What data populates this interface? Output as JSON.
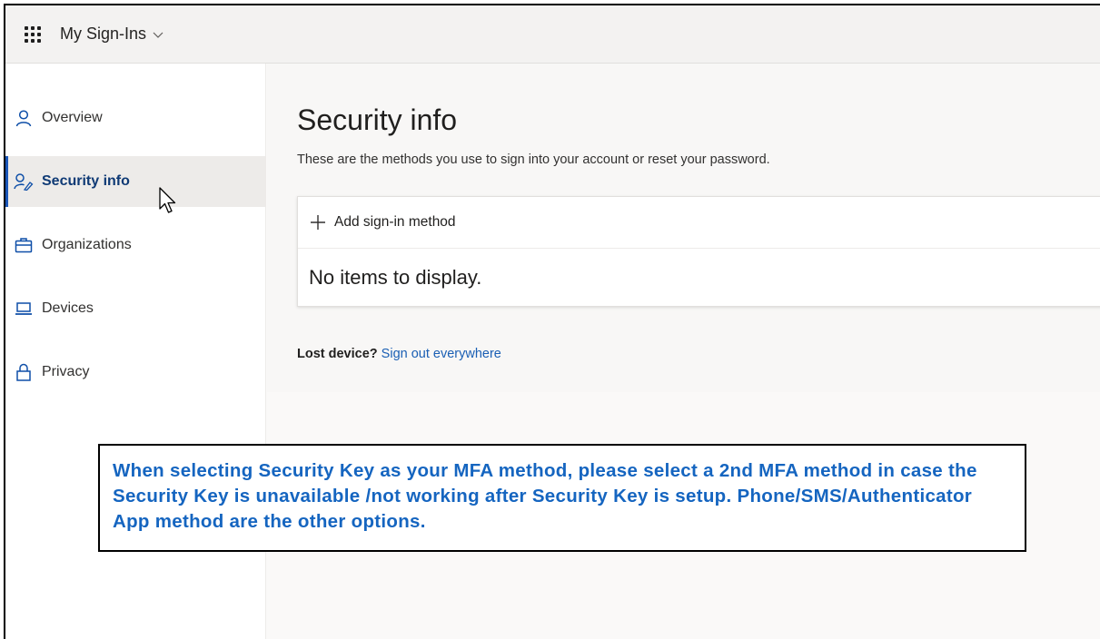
{
  "header": {
    "app_title": "My Sign-Ins",
    "icons": {
      "waffle": "app-launcher-icon",
      "chevron": "chevron-down-icon"
    }
  },
  "sidebar": {
    "items": [
      {
        "label": "Overview",
        "icon": "person-icon",
        "active": false
      },
      {
        "label": "Security info",
        "icon": "person-key-icon",
        "active": true
      },
      {
        "label": "Organizations",
        "icon": "briefcase-icon",
        "active": false
      },
      {
        "label": "Devices",
        "icon": "laptop-icon",
        "active": false
      },
      {
        "label": "Privacy",
        "icon": "lock-icon",
        "active": false
      }
    ]
  },
  "main": {
    "title": "Security info",
    "description": "These are the methods you use to sign into your account or reset your password.",
    "add_method_label": "Add sign-in method",
    "empty_text": "No items to display.",
    "lost_device_label": "Lost device?",
    "sign_out_link": "Sign out everywhere"
  },
  "callout": {
    "text": "When selecting Security Key as your MFA method, please select a 2nd MFA method in case the Security Key is unavailable /not working after Security Key is setup.  Phone/SMS/Authenticator App method are the other options."
  },
  "colors": {
    "accent": "#1a56b8",
    "link": "#1a5fb4",
    "callout_text": "#1565c0",
    "active_text": "#0f3a75"
  }
}
